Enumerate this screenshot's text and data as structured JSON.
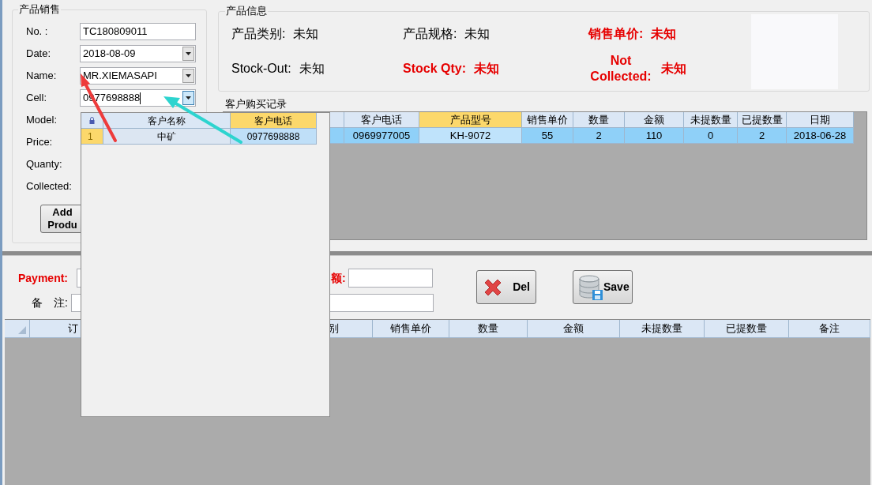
{
  "sales_panel": {
    "title": "产品销售",
    "fields": [
      {
        "label": "No. :",
        "kind": "text",
        "value": "TC180809011"
      },
      {
        "label": "Date:",
        "kind": "combo",
        "value": "2018-08-09",
        "open": false
      },
      {
        "label": "Name:",
        "kind": "combo",
        "value": "MR.XIEMASAPI",
        "open": false
      },
      {
        "label": "Cell:",
        "kind": "combo",
        "value": "0977698888",
        "open": true
      }
    ],
    "covered_labels": [
      "Model:",
      "Price:",
      "Quanty:",
      "Collected:"
    ],
    "add_button": [
      "Add",
      "Produ"
    ]
  },
  "product_info": {
    "title": "产品信息",
    "items": [
      {
        "label": "产品类别:",
        "value": "未知",
        "highlight": false
      },
      {
        "label": "产品规格:",
        "value": "未知",
        "highlight": false
      },
      {
        "label": "销售单价:",
        "value": "未知",
        "highlight": true
      },
      {
        "label": "Stock-Out:",
        "value": "未知",
        "highlight": false
      },
      {
        "label": "Stock Qty:",
        "value": "未知",
        "highlight": true
      },
      {
        "label": "Not Collected:",
        "value": "未知",
        "highlight": true
      }
    ]
  },
  "purchase_records": {
    "title": "客户购买记录",
    "columns": [
      {
        "label": "客户电话",
        "selected": false
      },
      {
        "label": "产品型号",
        "selected": true
      },
      {
        "label": "销售单价",
        "selected": false
      },
      {
        "label": "数量",
        "selected": false
      },
      {
        "label": "金额",
        "selected": false
      },
      {
        "label": "未提数量",
        "selected": false
      },
      {
        "label": "已提数量",
        "selected": false
      },
      {
        "label": "日期",
        "selected": false
      }
    ],
    "rows": [
      {
        "selected": true,
        "cells": [
          "0969977005",
          "KH-9072",
          "55",
          "2",
          "110",
          "0",
          "2",
          "2018-06-28"
        ]
      }
    ]
  },
  "order_form": {
    "payment_label": "Payment:",
    "amount_label": "额:",
    "remark_label": "备　注:",
    "buttons": [
      {
        "kind": "delete",
        "label": "Del"
      },
      {
        "kind": "save",
        "label": "Save"
      }
    ]
  },
  "order_table": {
    "columns": [
      "订",
      "别",
      "销售单价",
      "数量",
      "金额",
      "未提数量",
      "已提数量",
      "备注"
    ]
  },
  "customer_popup": {
    "columns": [
      {
        "label": "客户名称",
        "selected": false
      },
      {
        "label": "客户电话",
        "selected": true
      }
    ],
    "rows": [
      {
        "index": "1",
        "selected": true,
        "cells": [
          "中矿",
          "0977698888"
        ]
      }
    ]
  }
}
